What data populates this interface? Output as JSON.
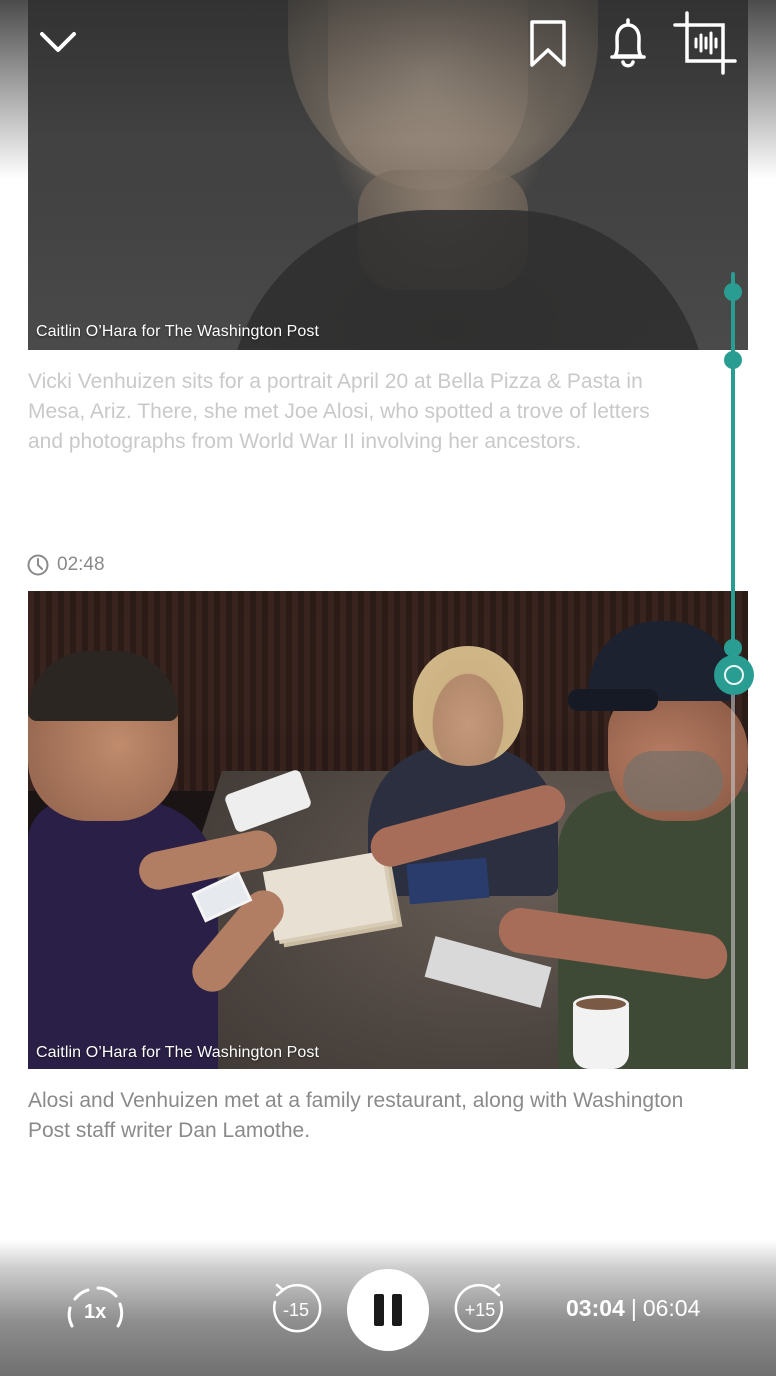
{
  "header": {
    "icons": [
      "chevron-down-icon",
      "bookmark-icon",
      "bell-icon",
      "clip-audio-icon"
    ]
  },
  "items": [
    {
      "credit": "Caitlin O’Hara for The Washington Post",
      "caption": "Vicki Venhuizen sits for a portrait April 20 at Bella Pizza & Pasta in Mesa, Ariz. There, she met Joe Alosi, who spotted a trove of letters and photographs from World War II involving her ancestors."
    },
    {
      "timestamp": "02:48",
      "credit": "Caitlin O’Hara for The Washington Post",
      "caption": "Alosi and Venhuizen met at a family restaurant, along with Washington Post staff writer Dan Lamothe."
    }
  ],
  "player": {
    "speed": "1x",
    "back_label": "-15",
    "forward_label": "+15",
    "current_time": "03:04",
    "separator": "|",
    "total_time": "06:04"
  },
  "colors": {
    "accent": "#2a9d93",
    "caption_faded": "#c9c9c9",
    "caption": "#8a8a8a"
  }
}
